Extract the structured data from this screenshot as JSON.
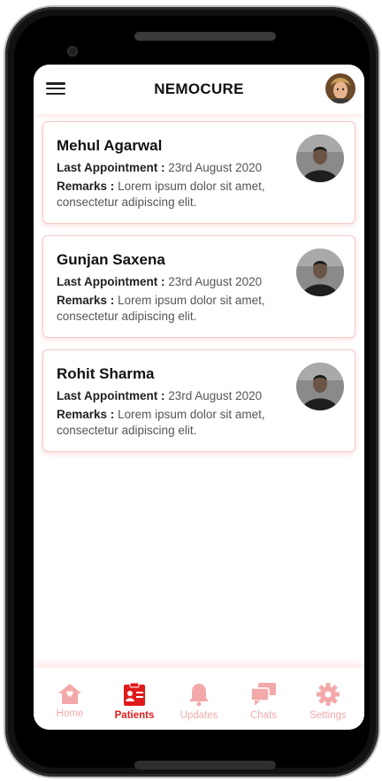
{
  "header": {
    "title": "NEMOCURE"
  },
  "patients": [
    {
      "name": "Mehul Agarwal",
      "appointment_label": "Last Appointment :",
      "appointment_value": "23rd August 2020",
      "remarks_label": "Remarks :",
      "remarks_value": "Lorem ipsum dolor sit amet, consectetur adipiscing elit."
    },
    {
      "name": "Gunjan Saxena",
      "appointment_label": "Last Appointment :",
      "appointment_value": "23rd August 2020",
      "remarks_label": "Remarks :",
      "remarks_value": "Lorem ipsum dolor sit amet, consectetur adipiscing elit."
    },
    {
      "name": "Rohit Sharma",
      "appointment_label": "Last Appointment :",
      "appointment_value": "23rd August 2020",
      "remarks_label": "Remarks :",
      "remarks_value": "Lorem ipsum dolor sit amet, consectetur adipiscing elit."
    }
  ],
  "nav": [
    {
      "label": "Home",
      "icon": "home-icon",
      "active": false
    },
    {
      "label": "Patients",
      "icon": "patients-icon",
      "active": true
    },
    {
      "label": "Updates",
      "icon": "bell-icon",
      "active": false
    },
    {
      "label": "Chats",
      "icon": "chat-icon",
      "active": false
    },
    {
      "label": "Settings",
      "icon": "gear-icon",
      "active": false
    }
  ],
  "colors": {
    "accent": "#e01b1b",
    "accent_light": "#f3a9a9",
    "card_border": "#f6c9c9"
  }
}
